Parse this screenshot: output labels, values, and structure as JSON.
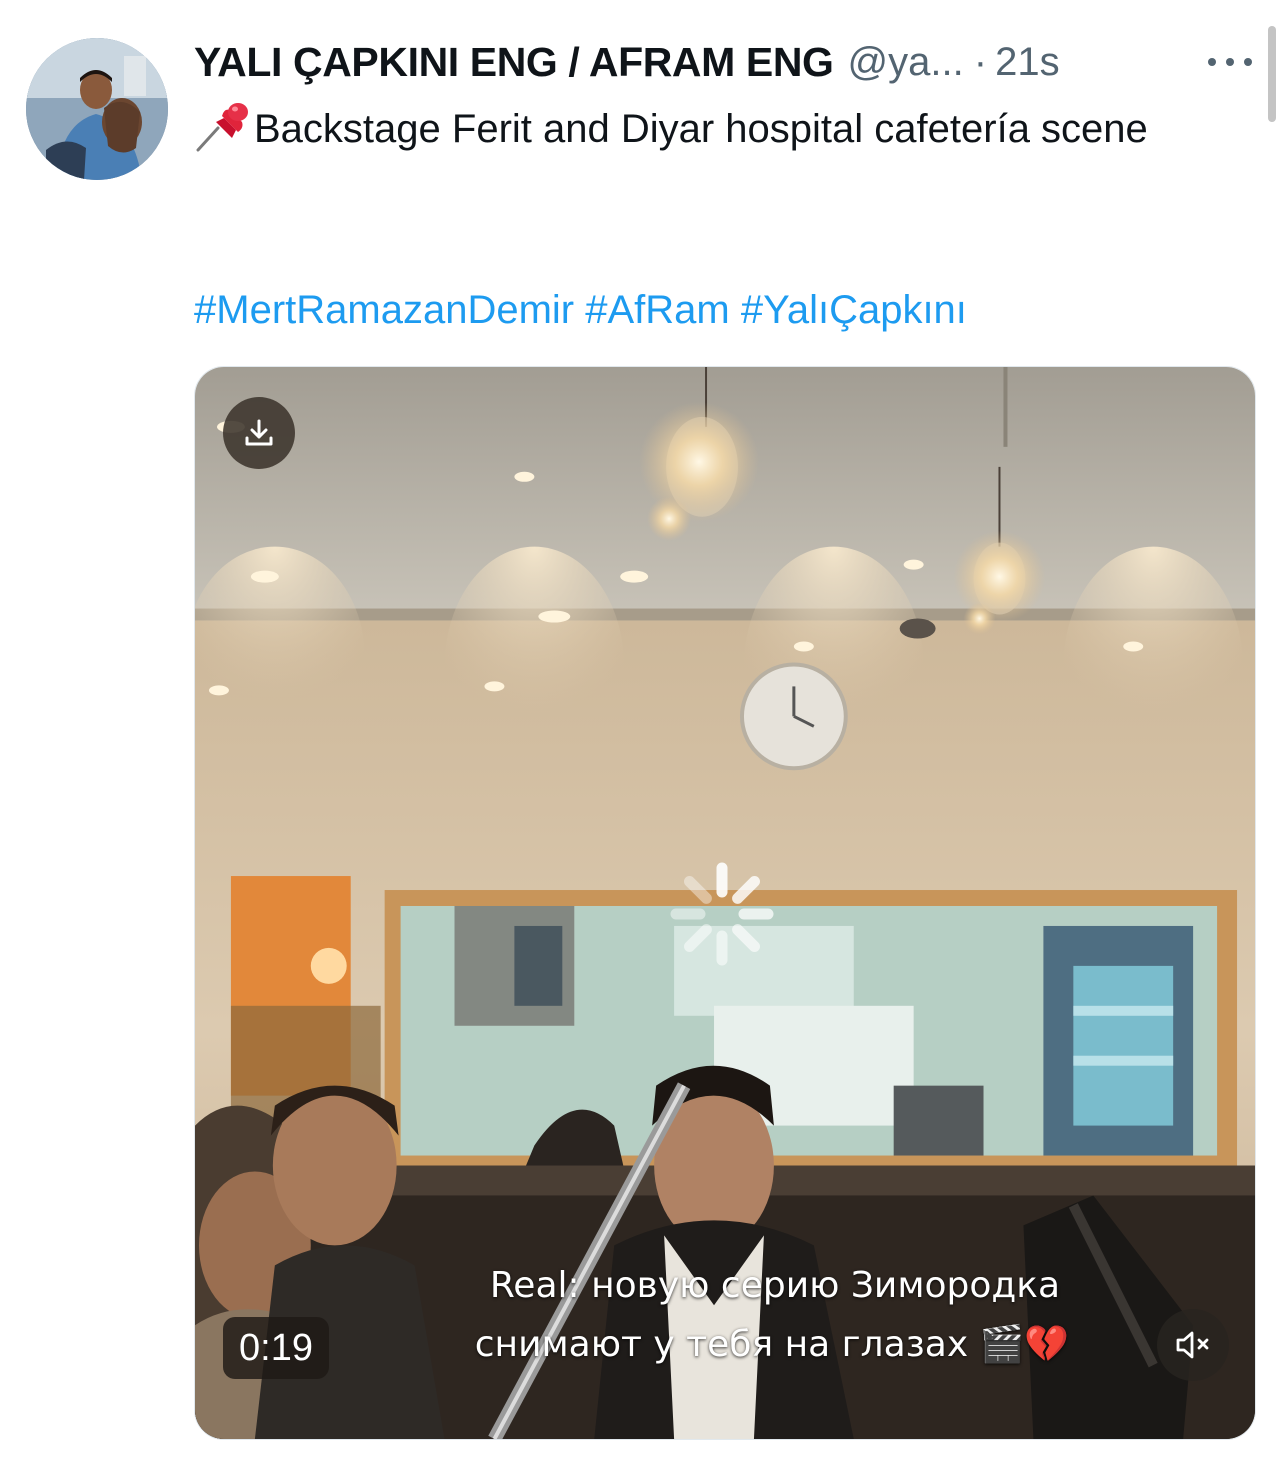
{
  "tweet": {
    "display_name": "YALI ÇAPKINI ENG / AFRAM ENG",
    "handle": "@ya...",
    "separator": "·",
    "time": "21s",
    "text": "Backstage Ferit and Diyar hospital cafetería scene",
    "hashtags": [
      "#MertRamazanDemir",
      "#AfRam",
      "#YalıÇapkını"
    ],
    "media": {
      "type": "video",
      "duration": "0:19",
      "caption_line_1": "Real: новую серию Зимородка",
      "caption_line_2": "снимают у тебя на глазах 🎬💔",
      "muted": true
    }
  },
  "icons": {
    "more": "more-horizontal-icon",
    "pin": "pushpin-icon",
    "download": "download-icon",
    "loading": "loading-spinner-icon",
    "mute": "volume-muted-icon"
  },
  "colors": {
    "link": "#1d9bf0",
    "secondary_text": "#536471",
    "primary_text": "#0f1419"
  }
}
